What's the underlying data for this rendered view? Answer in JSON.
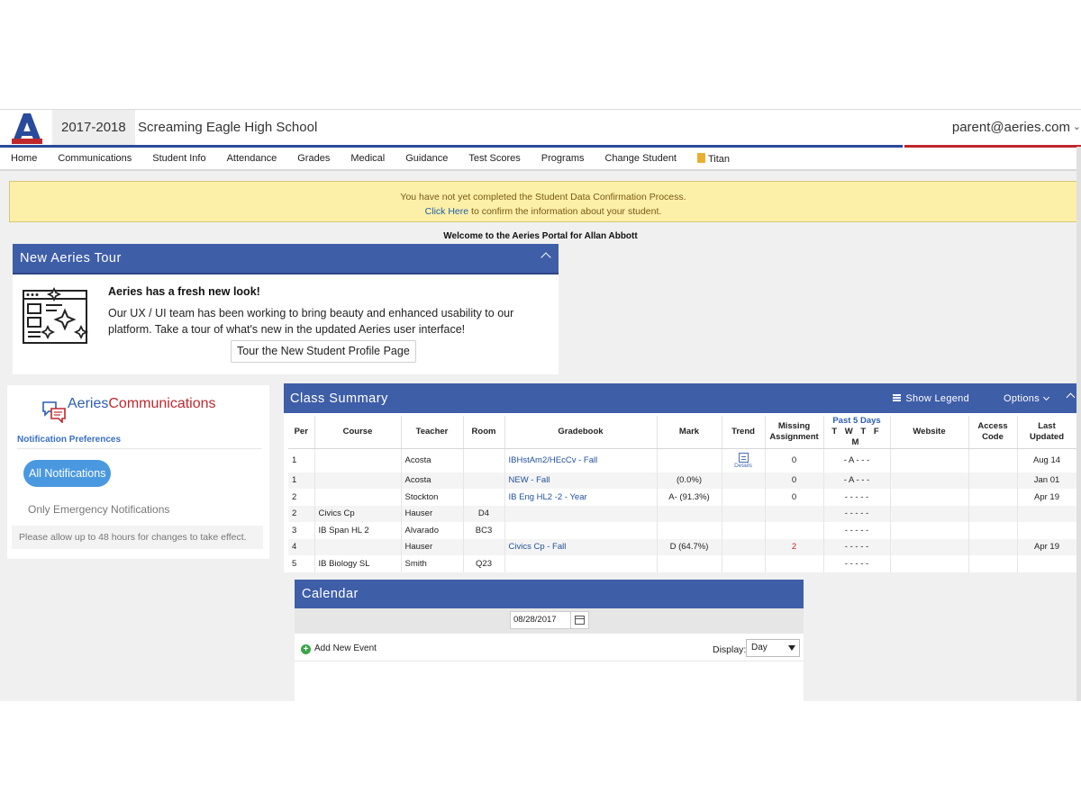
{
  "header": {
    "logo_icon": "aeries-a-logo",
    "school_year": "2017-2018",
    "school_name": "Screaming Eagle High School",
    "user_email": "parent@aeries.com",
    "accent_blue": "#2a4a9b",
    "accent_red": "#c0272d"
  },
  "nav": {
    "items": [
      {
        "label": "Home"
      },
      {
        "label": "Communications"
      },
      {
        "label": "Student Info"
      },
      {
        "label": "Attendance"
      },
      {
        "label": "Grades"
      },
      {
        "label": "Medical"
      },
      {
        "label": "Guidance"
      },
      {
        "label": "Test Scores"
      },
      {
        "label": "Programs"
      },
      {
        "label": "Change Student"
      },
      {
        "label": "Titan"
      }
    ]
  },
  "alert": {
    "line1": "You have not yet completed the Student Data Confirmation Process.",
    "link": "Click Here",
    "line2_rest": " to confirm the information about your student."
  },
  "welcome": "Welcome to the Aeries Portal for Allan Abbott",
  "tour": {
    "title": "New Aeries Tour",
    "heading": "Aeries has a fresh new look!",
    "body": "Our UX / UI team has been working to bring beauty and enhanced usability to our platform. Take a tour of what's new in the updated Aeries user interface!",
    "button": "Tour the New Student Profile Page"
  },
  "communications": {
    "brand_a": "Aeries",
    "brand_b": "Communications",
    "prefs_label": "Notification Preferences",
    "all_btn": "All Notifications",
    "emergency_only": "Only Emergency Notifications",
    "note": "Please allow up to 48 hours for changes to take effect."
  },
  "class_summary": {
    "title": "Class Summary",
    "show_legend": "Show Legend",
    "options": "Options",
    "columns": {
      "per": "Per",
      "course": "Course",
      "teacher": "Teacher",
      "room": "Room",
      "gradebook": "Gradebook",
      "mark": "Mark",
      "trend": "Trend",
      "missing_1": "Missing",
      "missing_2": "Assignment",
      "past5": "Past 5 Days",
      "days": "T W T F M",
      "website": "Website",
      "access_1": "Access",
      "access_2": "Code",
      "updated_1": "Last",
      "updated_2": "Updated"
    },
    "details_label": "Details",
    "rows": [
      {
        "per": "1",
        "course": "",
        "teacher": "Acosta",
        "room": "",
        "gradebook": "IBHstAm2/HEcCv - Fall",
        "mark": "",
        "trend": true,
        "missing": "0",
        "days": "- A - - -",
        "website": "",
        "access": "",
        "updated": "Aug 14"
      },
      {
        "per": "1",
        "course": "",
        "teacher": "Acosta",
        "room": "",
        "gradebook": "NEW - Fall",
        "mark": "(0.0%)",
        "trend": false,
        "missing": "0",
        "days": "- A - - -",
        "website": "",
        "access": "",
        "updated": "Jan 01"
      },
      {
        "per": "2",
        "course": "",
        "teacher": "Stockton",
        "room": "",
        "gradebook": "IB Eng HL2 -2 - Year",
        "mark": "A- (91.3%)",
        "trend": false,
        "missing": "0",
        "days": "- - - - -",
        "website": "",
        "access": "",
        "updated": "Apr 19"
      },
      {
        "per": "2",
        "course": "Civics Cp",
        "teacher": "Hauser",
        "room": "D4",
        "gradebook": "",
        "mark": "",
        "trend": false,
        "missing": "",
        "days": "- - - - -",
        "website": "",
        "access": "",
        "updated": ""
      },
      {
        "per": "3",
        "course": "IB Span HL 2",
        "teacher": "Alvarado",
        "room": "BC3",
        "gradebook": "",
        "mark": "",
        "trend": false,
        "missing": "",
        "days": "- - - - -",
        "website": "",
        "access": "",
        "updated": ""
      },
      {
        "per": "4",
        "course": "",
        "teacher": "Hauser",
        "room": "",
        "gradebook": "Civics Cp - Fall",
        "mark": "D (64.7%)",
        "trend": false,
        "missing": "2",
        "days": "- - - - -",
        "website": "",
        "access": "",
        "updated": "Apr 19"
      },
      {
        "per": "5",
        "course": "IB Biology SL",
        "teacher": "Smith",
        "room": "Q23",
        "gradebook": "",
        "mark": "",
        "trend": false,
        "missing": "",
        "days": "- - - - -",
        "website": "",
        "access": "",
        "updated": ""
      }
    ]
  },
  "calendar": {
    "title": "Calendar",
    "date": "08/28/2017",
    "add_event": "Add New Event",
    "display_label": "Display:",
    "display_value": "Day"
  }
}
